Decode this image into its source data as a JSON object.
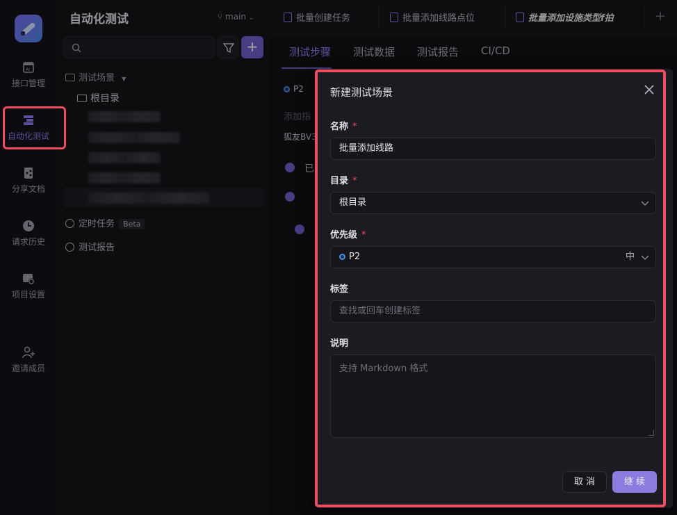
{
  "rail": {
    "items": [
      {
        "label": "接口管理",
        "icon": "api-icon"
      },
      {
        "label": "自动化测试",
        "icon": "automation-icon"
      },
      {
        "label": "分享文档",
        "icon": "share-doc-icon"
      },
      {
        "label": "请求历史",
        "icon": "history-icon"
      },
      {
        "label": "项目设置",
        "icon": "settings-icon"
      },
      {
        "label": "邀请成员",
        "icon": "invite-icon"
      }
    ]
  },
  "tree": {
    "title": "自动化测试",
    "branch": "main",
    "scenes_label": "测试场景",
    "root_label": "根目录",
    "timer_label": "定时任务",
    "beta": "Beta",
    "report_label": "测试报告"
  },
  "tabs": [
    {
      "label": "批量创建任务"
    },
    {
      "label": "批量添加线路点位"
    },
    {
      "label": "批量添加设施类型f拍"
    }
  ],
  "subtabs": [
    "测试步骤",
    "测试数据",
    "测试报告",
    "CI/CD"
  ],
  "behind": {
    "priority": "P2",
    "add_step": "添加指",
    "env": "狐友BV3",
    "done": "已"
  },
  "modal": {
    "title": "新建测试场景",
    "name_label": "名称",
    "name_value": "批量添加线路",
    "dir_label": "目录",
    "dir_value": "根目录",
    "priority_label": "优先级",
    "priority_value": "P2",
    "priority_level": "中",
    "tags_label": "标签",
    "tags_placeholder": "查找或回车创建标签",
    "desc_label": "说明",
    "desc_placeholder": "支持 Markdown 格式",
    "cancel": "取 消",
    "continue": "继 续",
    "required_mark": "*"
  },
  "colors": {
    "accent": "#8f7cf0",
    "highlight": "#ef4d61"
  }
}
